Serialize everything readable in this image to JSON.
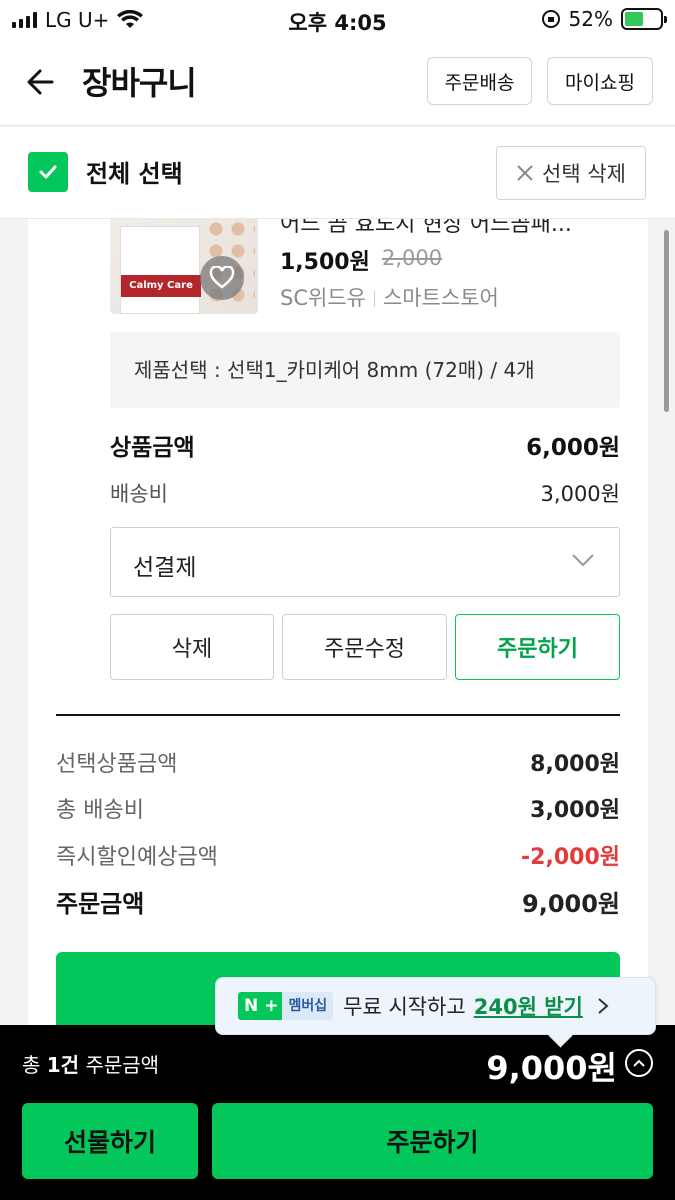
{
  "status_bar": {
    "carrier": "LG U+",
    "time": "오후 4:05",
    "battery": "52%",
    "battery_level": 0.52
  },
  "header": {
    "title": "장바구니",
    "delivery_button": "주문배송",
    "myshopping_button": "마이쇼핑"
  },
  "select_bar": {
    "select_all": "전체 선택",
    "delete_selected": "선택 삭제"
  },
  "product": {
    "name": "어느 곰 효도지 현상 어느곰패...",
    "price": "1,500원",
    "original_price": "2,000",
    "seller": "SC위드유",
    "store_type": "스마트스토어",
    "option": "제품선택 : 선택1_카미케어 8mm (72매) / 4개",
    "thumbnail_label": "Calmy Care",
    "amount_label": "상품금액",
    "amount_value": "6,000원",
    "shipping_label": "배송비",
    "shipping_value": "3,000원",
    "payment_select": "선결제",
    "delete_button": "삭제",
    "edit_button": "주문수정",
    "order_button": "주문하기"
  },
  "summary": {
    "selected_label": "선택상품금액",
    "selected_value": "8,000원",
    "shipping_label": "총 배송비",
    "shipping_value": "3,000원",
    "discount_label": "즉시할인예상금액",
    "discount_value": "-2,000원",
    "total_label": "주문금액",
    "total_value": "9,000원"
  },
  "tooltip": {
    "badge_n": "N",
    "badge_plus": "+",
    "badge_membership": "멤버십",
    "text": "무료 시작하고",
    "highlight": "240원 받기"
  },
  "bottom_bar": {
    "count_prefix": "총",
    "count": "1건",
    "count_suffix": "주문금액",
    "total": "9,000원",
    "gift_button": "선물하기",
    "buy_button": "주문하기"
  },
  "colors": {
    "accent": "#03c75a",
    "discount": "#e23b3b"
  }
}
